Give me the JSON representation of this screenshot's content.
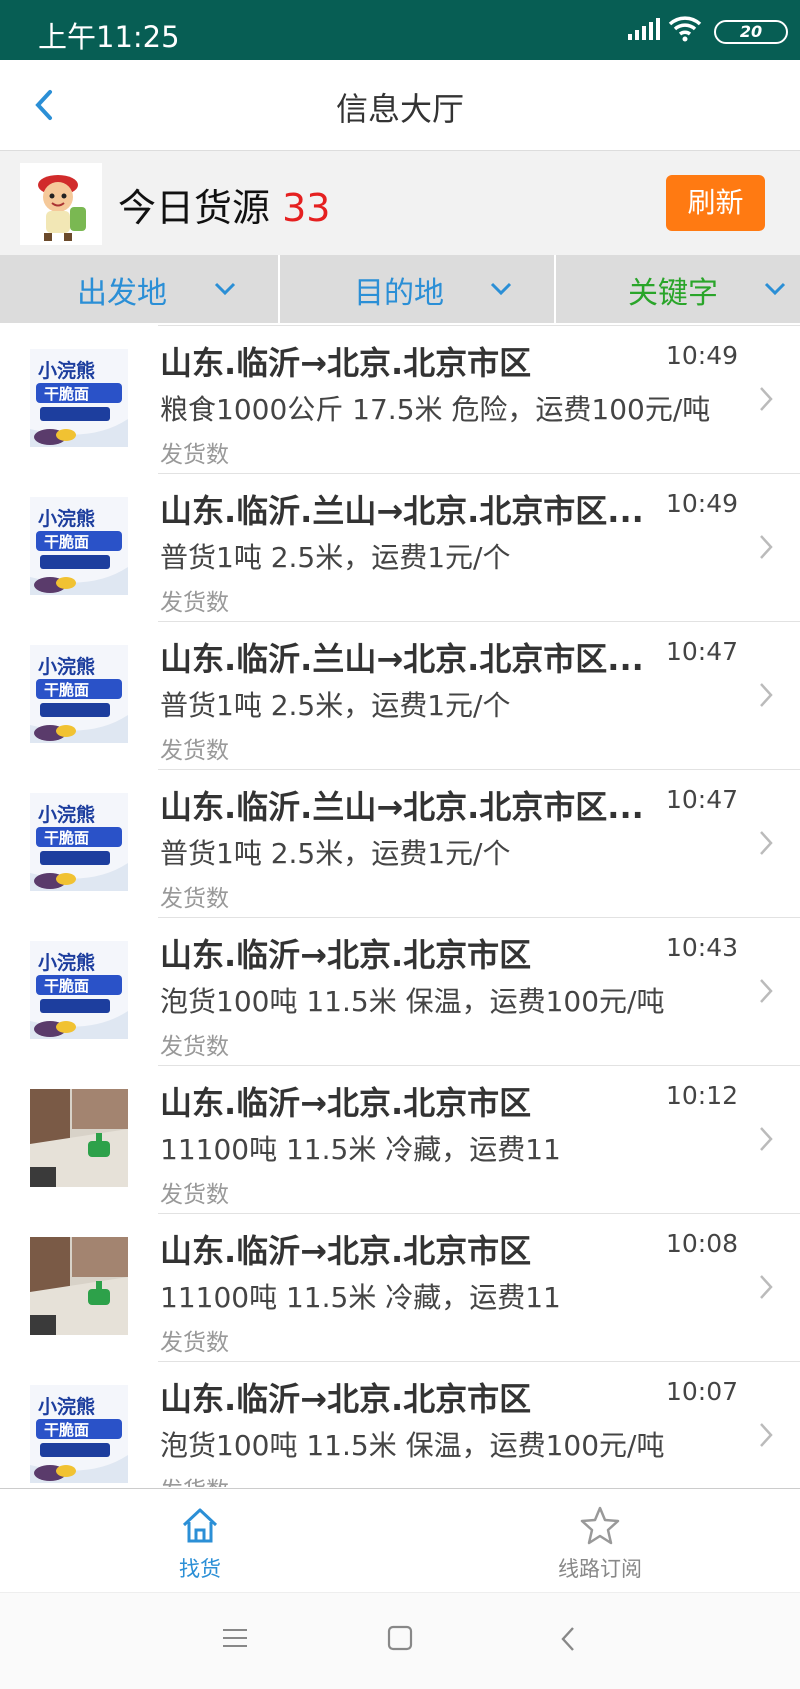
{
  "status_bar": {
    "time": "上午11:25",
    "battery": "20"
  },
  "header": {
    "title": "信息大厅"
  },
  "today": {
    "label": "今日货源",
    "count": "33",
    "refresh_label": "刷新"
  },
  "filters": [
    {
      "label": "出发地",
      "color": "#2b8fd6"
    },
    {
      "label": "目的地",
      "color": "#2b8fd6"
    },
    {
      "label": "关键字",
      "color": "#2aa52a"
    }
  ],
  "listings": [
    {
      "route": "山东.临沂→北京.北京市区",
      "time": "10:49",
      "desc": "粮食1000公斤  17.5米 危险，运费100元/吨",
      "sub": "发货数",
      "thumb": "snack-package"
    },
    {
      "route": "山东.临沂.兰山→北京.北京市区...",
      "time": "10:49",
      "desc": "普货1吨  2.5米，运费1元/个",
      "sub": "发货数",
      "thumb": "snack-package"
    },
    {
      "route": "山东.临沂.兰山→北京.北京市区...",
      "time": "10:47",
      "desc": "普货1吨  2.5米，运费1元/个",
      "sub": "发货数",
      "thumb": "snack-package"
    },
    {
      "route": "山东.临沂.兰山→北京.北京市区...",
      "time": "10:47",
      "desc": "普货1吨  2.5米，运费1元/个",
      "sub": "发货数",
      "thumb": "snack-package"
    },
    {
      "route": "山东.临沂→北京.北京市区",
      "time": "10:43",
      "desc": "泡货100吨  11.5米 保温，运费100元/吨",
      "sub": "发货数",
      "thumb": "snack-package"
    },
    {
      "route": "山东.临沂→北京.北京市区",
      "time": "10:12",
      "desc": "11100吨  11.5米 冷藏，运费11",
      "sub": "发货数",
      "thumb": "room-photo"
    },
    {
      "route": "山东.临沂→北京.北京市区",
      "time": "10:08",
      "desc": "11100吨  11.5米 冷藏，运费11",
      "sub": "发货数",
      "thumb": "room-photo"
    },
    {
      "route": "山东.临沂→北京.北京市区",
      "time": "10:07",
      "desc": "泡货100吨  11.5米 保温，运费100元/吨",
      "sub": "发货数",
      "thumb": "snack-package"
    }
  ],
  "tabs": [
    {
      "label": "找货",
      "icon": "home-icon",
      "active": true
    },
    {
      "label": "线路订阅",
      "icon": "star-icon",
      "active": false
    }
  ],
  "colors": {
    "status_bar": "#075e54",
    "accent": "#2b8fd6",
    "refresh": "#ff7a12",
    "count": "#e52020",
    "keyword": "#2aa52a"
  }
}
